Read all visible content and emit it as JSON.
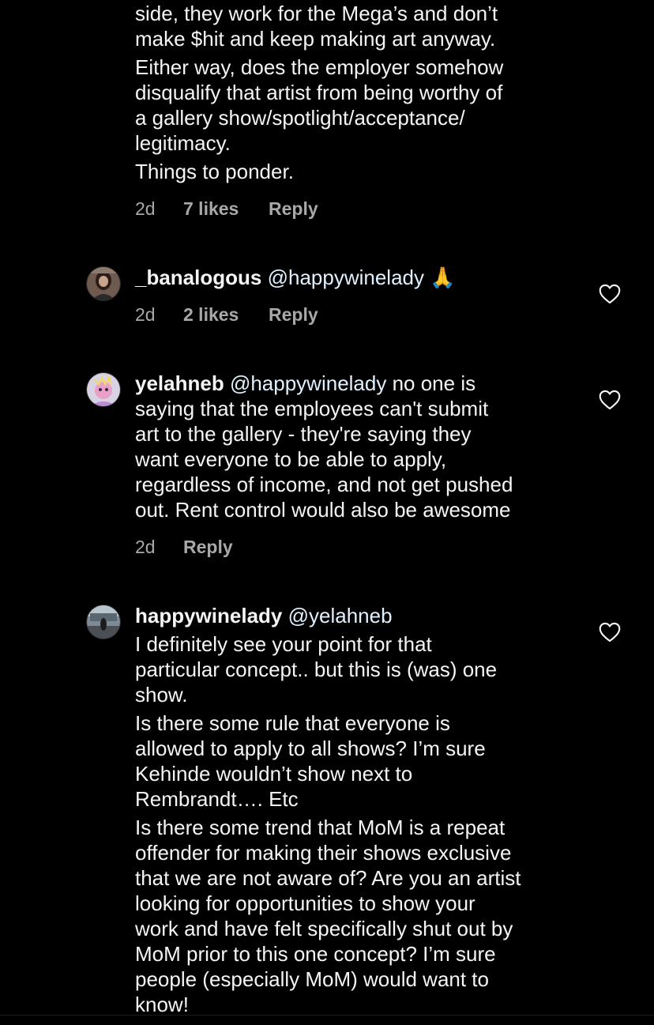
{
  "comment1": {
    "lines": [
      "side, they work for the Mega’s and don’t",
      "make $hit and keep making art anyway.",
      "Either way, does the employer somehow",
      "disqualify that artist from being worthy of",
      "a gallery show/spotlight/acceptance/",
      "legitimacy.",
      "Things to ponder."
    ],
    "time": "2d",
    "likes": "7 likes",
    "reply": "Reply"
  },
  "comment2": {
    "username": "_banalogous",
    "mention": "@happywinelady",
    "emoji": "🙏",
    "time": "2d",
    "likes": "2 likes",
    "reply": "Reply"
  },
  "comment3": {
    "username": "yelahneb",
    "mention": "@happywinelady",
    "first_line_rest": " no one is",
    "lines": [
      "saying that the employees can't submit",
      "art to the gallery - they're saying they",
      "want everyone to be able to apply,",
      "regardless of income, and not get pushed",
      "out. Rent control would also be awesome"
    ],
    "time": "2d",
    "reply": "Reply"
  },
  "comment4": {
    "username": "happywinelady",
    "mention": "@yelahneb",
    "lines": [
      "I definitely see your point for that",
      "particular concept.. but this is (was) one",
      "show.",
      "Is there some rule that everyone is",
      "allowed to apply to all shows? I’m sure",
      "Kehinde wouldn’t show next to",
      "Rembrandt…. Etc",
      "Is there some trend that MoM is a repeat",
      "offender for making their shows exclusive",
      "that we are not aware of? Are you an artist",
      "looking for opportunities to show your",
      "work and have felt specifically shut out by",
      "MoM prior to this one concept? I’m sure",
      "people (especially MoM) would want to",
      "know!"
    ]
  },
  "icons": {
    "like": "heart-outline-icon"
  },
  "colors": {
    "background": "#000000",
    "text": "#f5f5f5",
    "secondary": "#a8a8a8"
  }
}
